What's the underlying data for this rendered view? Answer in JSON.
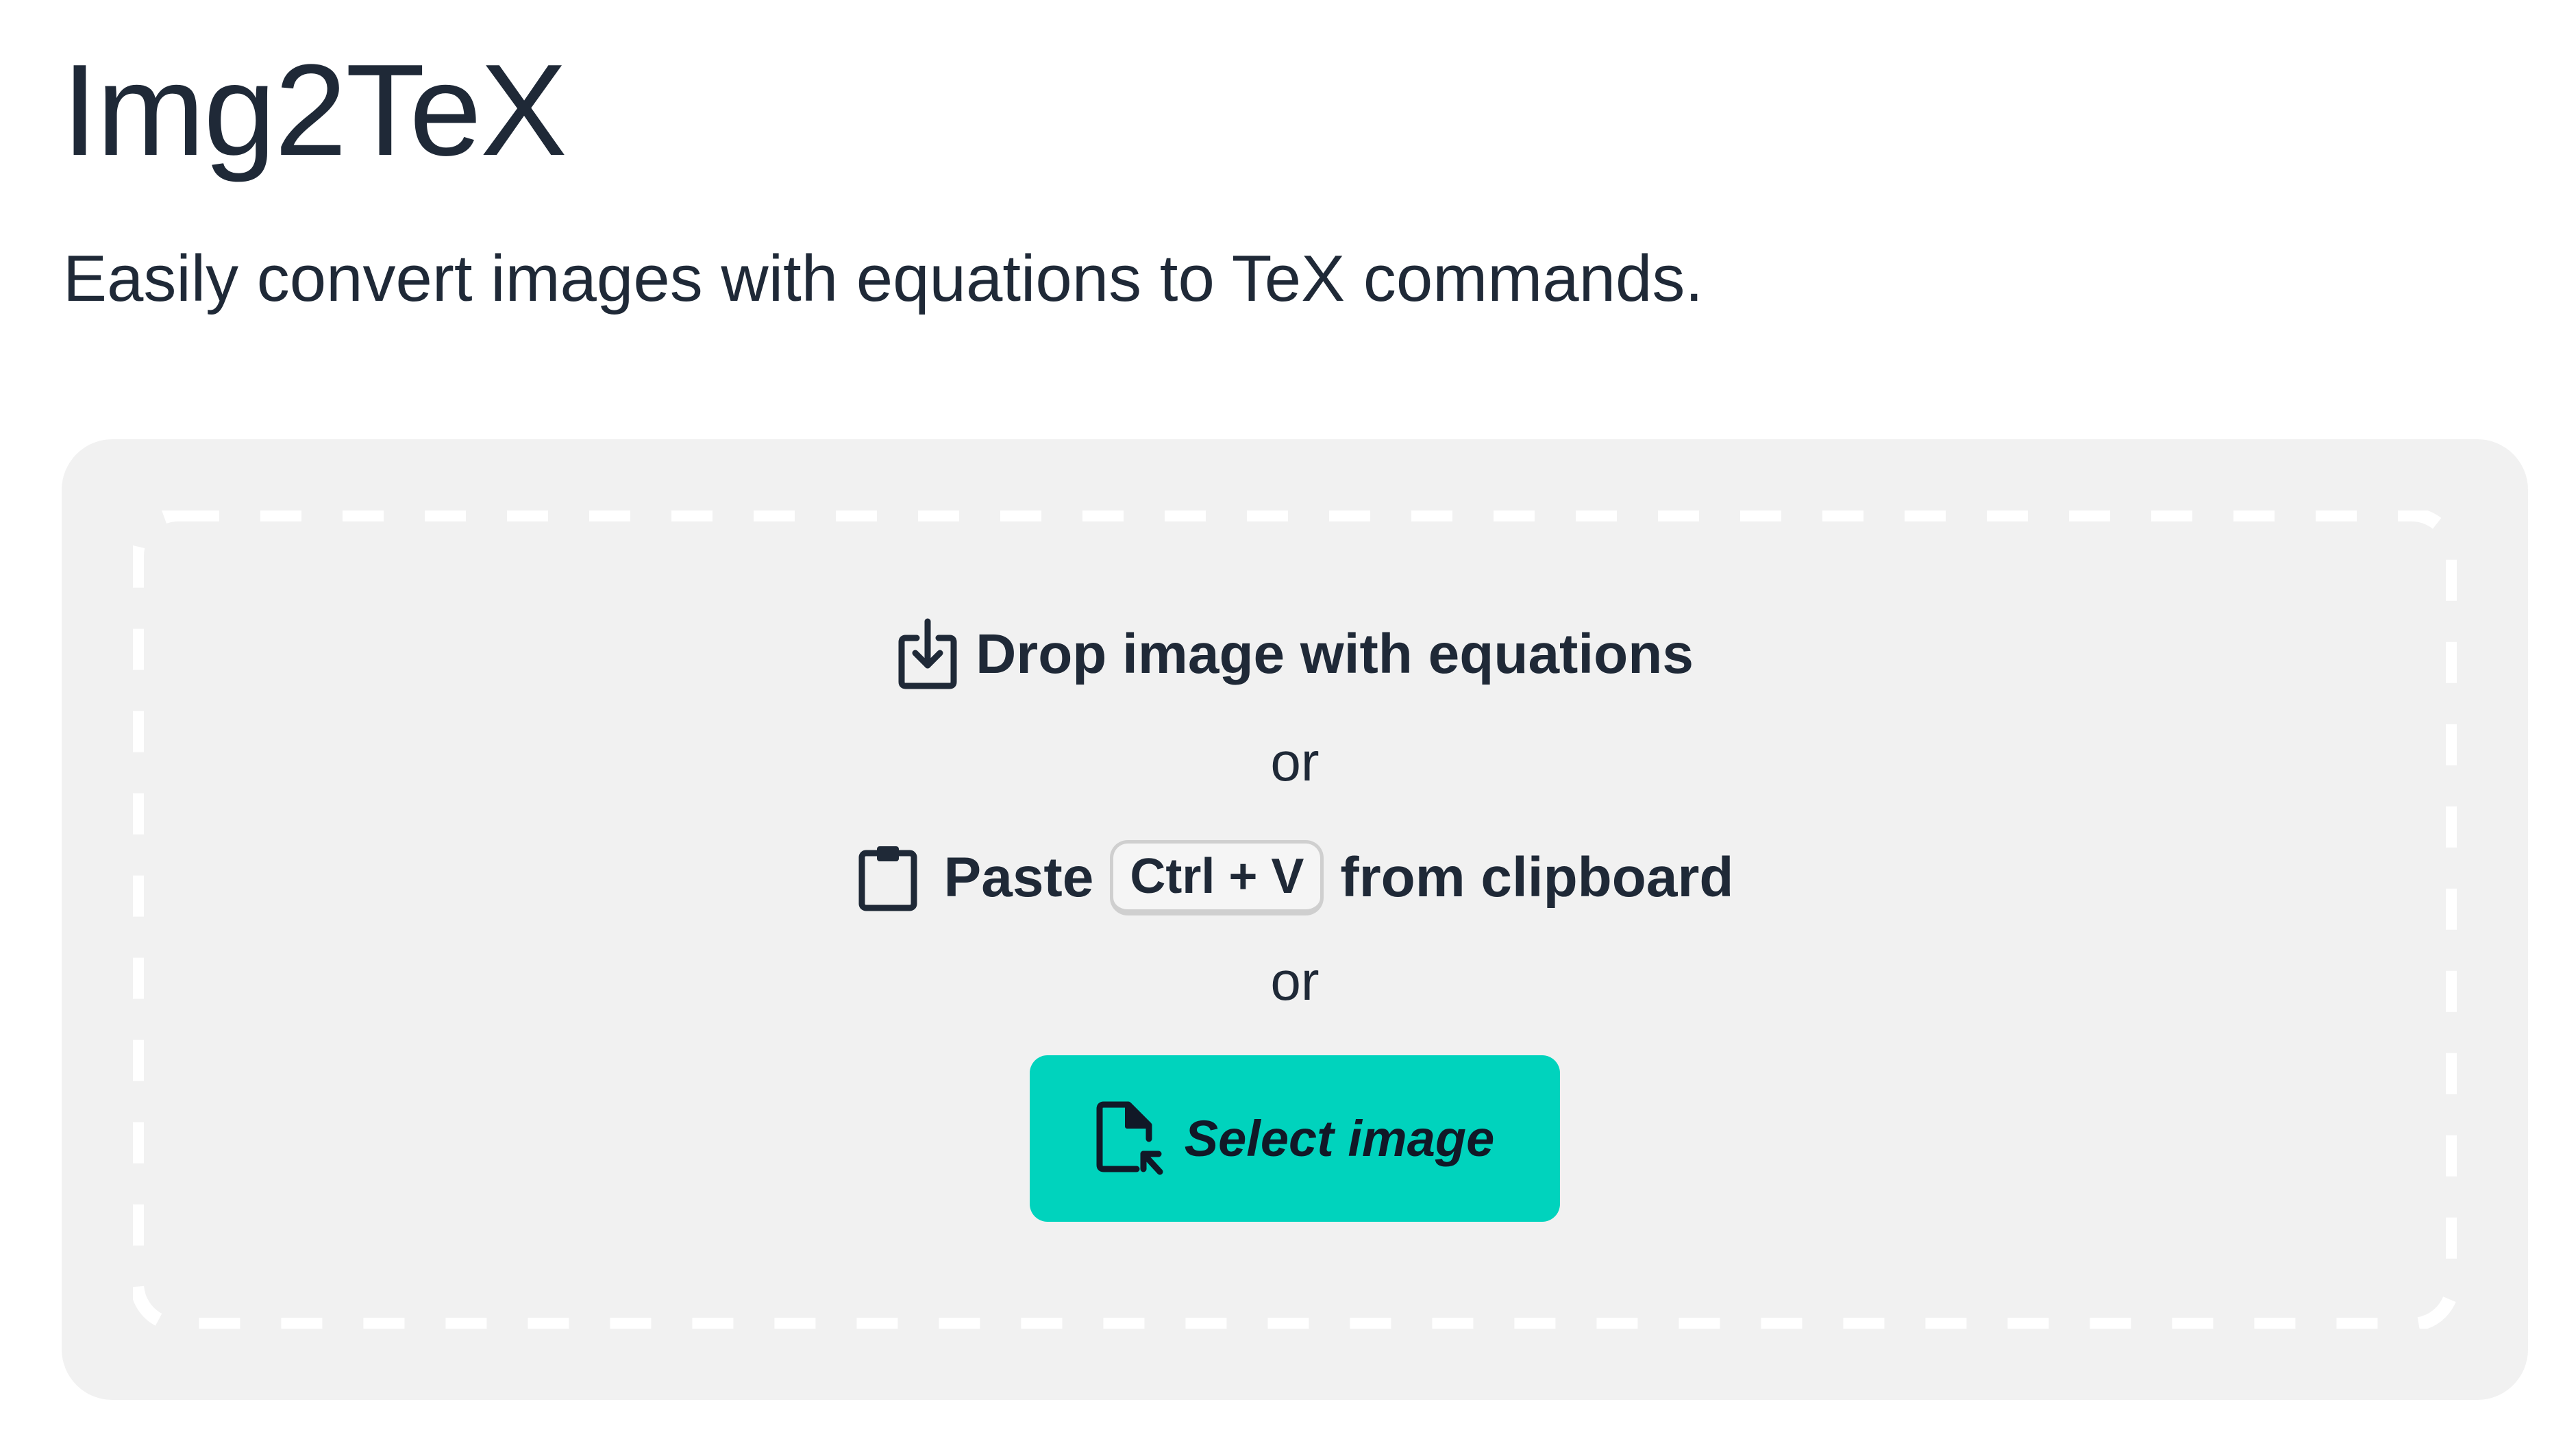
{
  "header": {
    "title": "Img2TeX",
    "subtitle": "Easily convert images with equations to TeX commands."
  },
  "dropzone": {
    "drop_text": "Drop image with equations",
    "or_1": "or",
    "paste_prefix": "Paste",
    "shortcut": "Ctrl + V",
    "paste_suffix": "from clipboard",
    "or_2": "or",
    "select_label": "Select image"
  },
  "icons": {
    "drop": "download-tray-icon",
    "paste": "clipboard-icon",
    "select": "file-pointer-icon"
  },
  "colors": {
    "text": "#1f2937",
    "panel_bg": "#f1f1f1",
    "button_bg": "#00d3bd",
    "dash": "#ffffff"
  }
}
